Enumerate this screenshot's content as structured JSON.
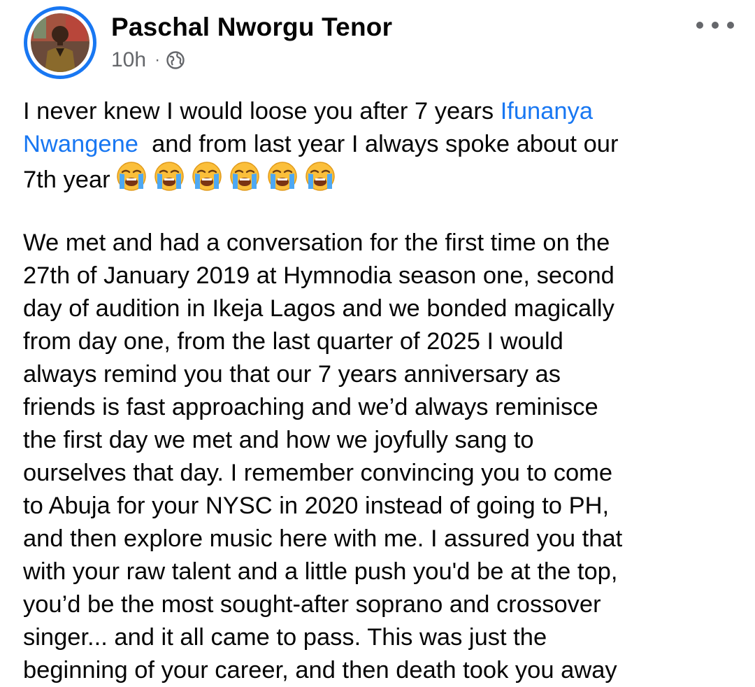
{
  "post": {
    "author": "Paschal Nworgu Tenor",
    "time": "10h",
    "separator": "·",
    "privacy_icon": "globe-icon",
    "menu_icon": "more-horizontal-icon",
    "mention_color": "#1877f2",
    "accent_color": "#1877f2"
  },
  "body": {
    "line1_pre": "I never knew I would loose you after 7 years ",
    "mention_part1": "Ifunanya",
    "mention_part2": "Nwangene",
    "line2_post": "  and from last year I always spoke about our",
    "line3_pre": "7th year",
    "emoji_name": "loudly-crying-face",
    "emoji_count": 6,
    "paragraph2": [
      "We met and had a conversation for the first time on the",
      "27th of January 2019 at Hymnodia season one, second",
      "day of audition in Ikeja Lagos and we bonded magically",
      "from day one, from the last quarter of 2025 I would",
      "always remind you that our 7 years anniversary as",
      "friends is fast approaching and we’d always reminisce",
      "the first day we met and how we joyfully sang to",
      "ourselves that day. I remember convincing you to come",
      "to Abuja for your NYSC in 2020 instead of going to PH,",
      "and then explore music here with me. I assured you that",
      "with your raw talent and a little push you'd be at the top,",
      "you’d be the most sought-after soprano and crossover",
      "singer... and it all came to pass. This was just the",
      "beginning of your career, and then death took you away"
    ]
  }
}
